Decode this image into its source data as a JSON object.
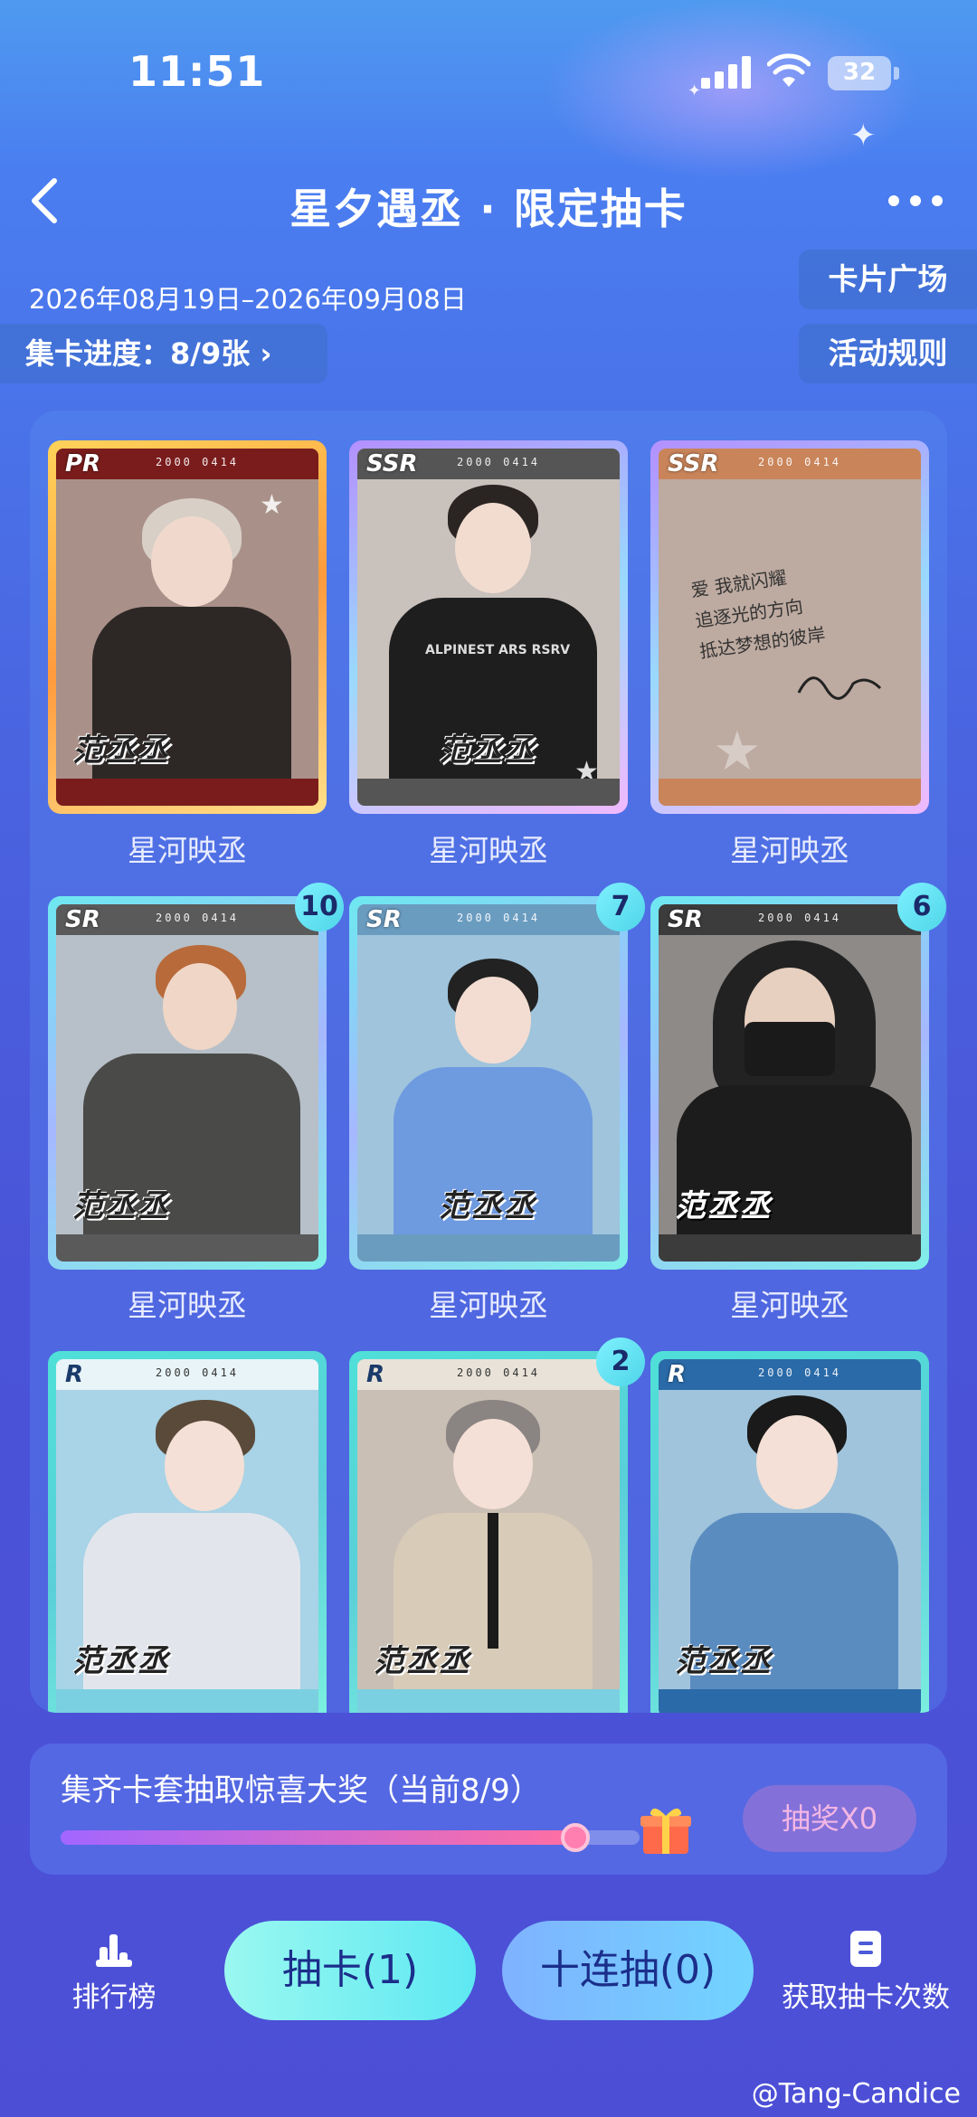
{
  "status_bar": {
    "time": "11:51",
    "battery": "32"
  },
  "header": {
    "title": "星夕遇丞 · 限定抽卡"
  },
  "event": {
    "date_range": "2026年08月19日–2026年09月08日",
    "progress_label": "集卡进度：8/9张 ›",
    "card_square_label": "卡片广场",
    "rules_label": "活动规则"
  },
  "cards": [
    {
      "rarity": "PR",
      "serial": "2000 0414",
      "name_stamp": "范丞丞",
      "label": "星河映丞",
      "count": "",
      "signature_lines": []
    },
    {
      "rarity": "SSR",
      "serial": "2000 0414",
      "name_stamp": "范丞丞",
      "label": "星河映丞",
      "count": "",
      "shirt_text": "ALPINEST ARS RSRV"
    },
    {
      "rarity": "SSR",
      "serial": "2000 0414",
      "name_stamp": "",
      "label": "星河映丞",
      "count": "",
      "signature_lines": [
        "爱 我就闪耀",
        "追逐光的方向",
        "抵达梦想的彼岸"
      ]
    },
    {
      "rarity": "SR",
      "serial": "2000 0414",
      "name_stamp": "范丞丞",
      "label": "星河映丞",
      "count": "10"
    },
    {
      "rarity": "SR",
      "serial": "2000 0414",
      "name_stamp": "范丞丞",
      "label": "星河映丞",
      "count": "7"
    },
    {
      "rarity": "SR",
      "serial": "2000 0414",
      "name_stamp": "范丞丞",
      "label": "星河映丞",
      "count": "6"
    },
    {
      "rarity": "R",
      "serial": "2000 0414",
      "name_stamp": "范丞丞",
      "label": "",
      "count": ""
    },
    {
      "rarity": "R",
      "serial": "2000 0414",
      "name_stamp": "范丞丞",
      "label": "",
      "count": "2"
    },
    {
      "rarity": "R",
      "serial": "2000 0414",
      "name_stamp": "范丞丞",
      "label": "",
      "count": ""
    }
  ],
  "reward": {
    "text": "集齐卡套抽取惊喜大奖（当前8/9）",
    "progress": 0.889,
    "button_label": "抽奖X0"
  },
  "bottom_bar": {
    "rank_label": "排行榜",
    "draw_one_label": "抽卡(1)",
    "draw_ten_label": "十连抽(0)",
    "get_more_label": "获取抽卡次数"
  },
  "watermark": "@Tang-Candice",
  "colors": {
    "accent_cyan": "#5ee8f2",
    "accent_pink": "#ff6ea3"
  }
}
